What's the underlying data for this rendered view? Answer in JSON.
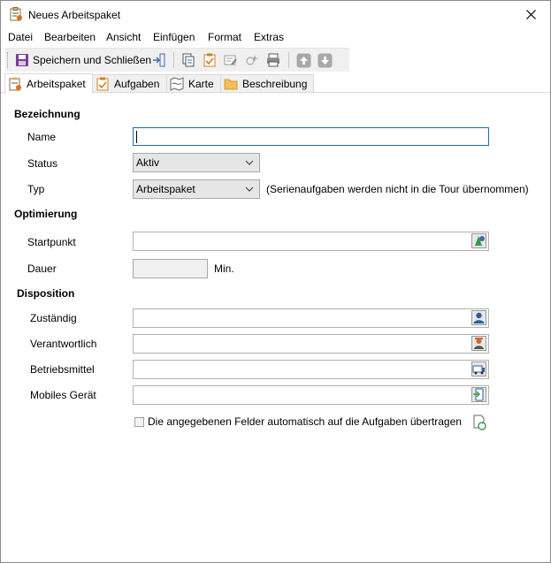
{
  "window": {
    "title": "Neues Arbeitspaket"
  },
  "menu": [
    {
      "label": "Datei"
    },
    {
      "label": "Bearbeiten"
    },
    {
      "label": "Ansicht"
    },
    {
      "label": "Einfügen"
    },
    {
      "label": "Format"
    },
    {
      "label": "Extras"
    }
  ],
  "toolbar": {
    "save_close_label": "Speichern und Schließen"
  },
  "tabs": [
    {
      "label": "Arbeitspaket",
      "active": true
    },
    {
      "label": "Aufgaben"
    },
    {
      "label": "Karte"
    },
    {
      "label": "Beschreibung"
    }
  ],
  "form": {
    "section_bezeichnung": "Bezeichnung",
    "name_label": "Name",
    "name_value": "",
    "status_label": "Status",
    "status_value": "Aktiv",
    "typ_label": "Typ",
    "typ_value": "Arbeitspaket",
    "typ_note": "(Serienaufgaben werden nicht in die Tour übernommen)",
    "section_optimierung": "Optimierung",
    "startpunkt_label": "Startpunkt",
    "dauer_label": "Dauer",
    "dauer_unit": "Min.",
    "section_disposition": "Disposition",
    "zustaendig_label": "Zuständig",
    "verantwortlich_label": "Verantwortlich",
    "betriebsmittel_label": "Betriebsmittel",
    "mobiles_label": "Mobiles Gerät",
    "auto_transfer_label": "Die angegebenen Felder automatisch auf die Aufgaben übertragen"
  },
  "colors": {
    "accent": "#1b6dac",
    "tab_bg": "#f0f0f0",
    "field_gray": "#e6e6e6"
  }
}
